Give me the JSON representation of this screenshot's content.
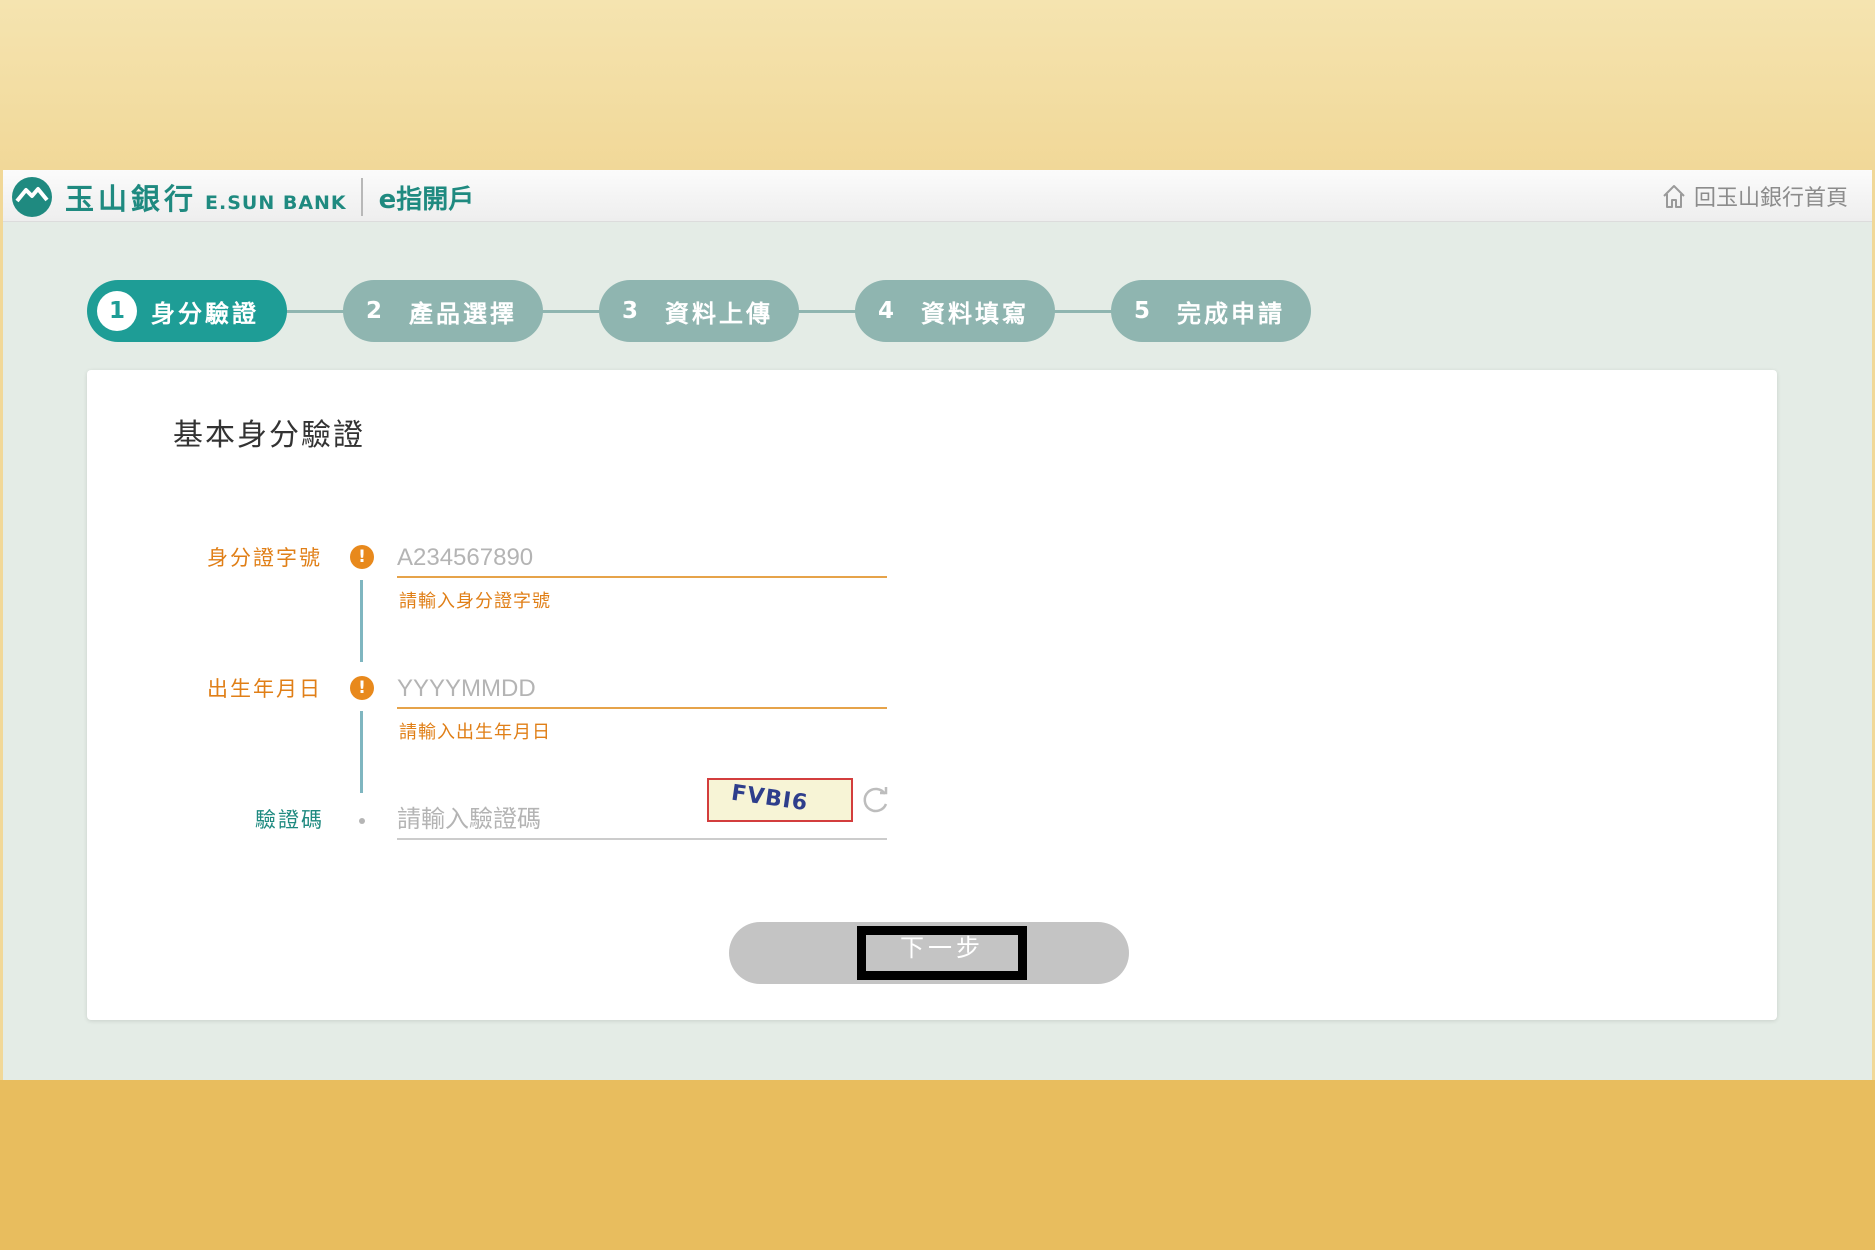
{
  "header": {
    "brand_zh": "玉山銀行",
    "brand_en": "E.SUN BANK",
    "app_name": "e指開戶",
    "home_link": "回玉山銀行首頁"
  },
  "steps": [
    {
      "num": "1",
      "label": "身分驗證",
      "active": true
    },
    {
      "num": "2",
      "label": "產品選擇",
      "active": false
    },
    {
      "num": "3",
      "label": "資料上傳",
      "active": false
    },
    {
      "num": "4",
      "label": "資料填寫",
      "active": false
    },
    {
      "num": "5",
      "label": "完成申請",
      "active": false
    }
  ],
  "form": {
    "title": "基本身分驗證",
    "id_field": {
      "label": "身分證字號",
      "placeholder": "A234567890",
      "value": "",
      "error": "請輸入身分證字號"
    },
    "birth_field": {
      "label": "出生年月日",
      "placeholder": "YYYYMMDD",
      "value": "",
      "error": "請輸入出生年月日"
    },
    "captcha_field": {
      "label": "驗證碼",
      "placeholder": "請輸入驗證碼",
      "value": "",
      "captcha_text": "FVBI6"
    },
    "next_button": "下一步"
  },
  "colors": {
    "brand_teal": "#1f8a80",
    "active_step": "#1e9d96",
    "inactive_step": "#8fb5b0",
    "warning_orange": "#e07f17",
    "button_disabled": "#c4c4c4"
  },
  "icons": [
    "esun-logo-icon",
    "home-icon",
    "warning-icon",
    "refresh-icon"
  ]
}
